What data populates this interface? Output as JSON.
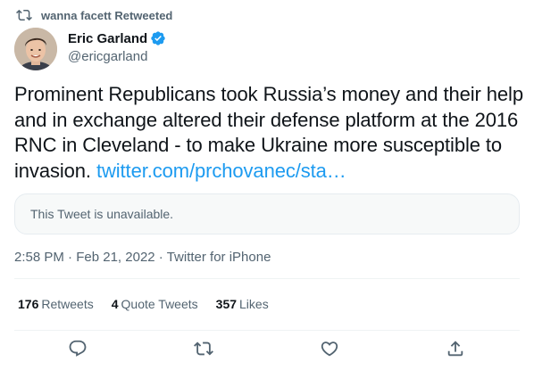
{
  "retweet_context": {
    "text": "wanna facett Retweeted",
    "icon": "retweet-icon"
  },
  "author": {
    "name": "Eric Garland",
    "handle": "@ericgarland",
    "verified": true,
    "avatar": "avatar-photo"
  },
  "tweet": {
    "text": "Prominent Republicans took Russia’s money and their help and in exchange altered their defense platform at the 2016 RNC in Cleveland - to make Ukraine more susceptible to invasion. ",
    "link_text": "twitter.com/prchovanec/sta…"
  },
  "quote": {
    "unavailable_text": "This Tweet is unavailable."
  },
  "meta": {
    "time": "2:58 PM",
    "separator": " · ",
    "date": "Feb 21, 2022",
    "source": "Twitter for iPhone"
  },
  "stats": {
    "retweets": {
      "count": "176",
      "label": "Retweets"
    },
    "quote_tweets": {
      "count": "4",
      "label": "Quote Tweets"
    },
    "likes": {
      "count": "357",
      "label": "Likes"
    }
  },
  "actions": {
    "reply": "reply-icon",
    "retweet": "retweet-icon",
    "like": "like-icon",
    "share": "share-icon"
  },
  "colors": {
    "link": "#1d9bf0",
    "secondary_text": "#536471",
    "primary_text": "#0f1419",
    "verified": "#1d9bf0"
  }
}
